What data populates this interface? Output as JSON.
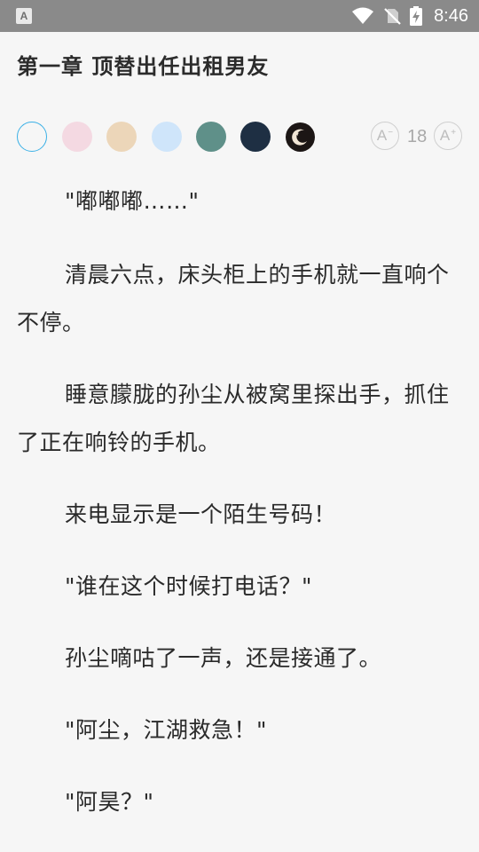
{
  "status_bar": {
    "app_icon": "A",
    "time": "8:46",
    "icons": [
      "wifi-icon",
      "no-sim-icon",
      "battery-charging-icon"
    ]
  },
  "chapter": {
    "title": "第一章 顶替出任出租男友"
  },
  "toolbar": {
    "themes": [
      {
        "name": "white",
        "color": "#f6f6f6",
        "selected": true
      },
      {
        "name": "pink",
        "color": "#f4d9e2"
      },
      {
        "name": "beige",
        "color": "#ecd6b9"
      },
      {
        "name": "light-blue",
        "color": "#cfe5fa"
      },
      {
        "name": "teal",
        "color": "#5f9089"
      },
      {
        "name": "navy",
        "color": "#1e2f43"
      }
    ],
    "night_mode_icon": "moon-stars-icon",
    "font_decrease_label": "A",
    "font_increase_label": "A",
    "font_size": "18"
  },
  "paragraphs": [
    "\"嘟嘟嘟……\"",
    "清晨六点，床头柜上的手机就一直响个不停。",
    "睡意朦胧的孙尘从被窝里探出手，抓住了正在响铃的手机。",
    "来电显示是一个陌生号码！",
    "\"谁在这个时候打电话？\"",
    "孙尘嘀咕了一声，还是接通了。",
    "\"阿尘，江湖救急！\"",
    "\"阿昊？\""
  ]
}
